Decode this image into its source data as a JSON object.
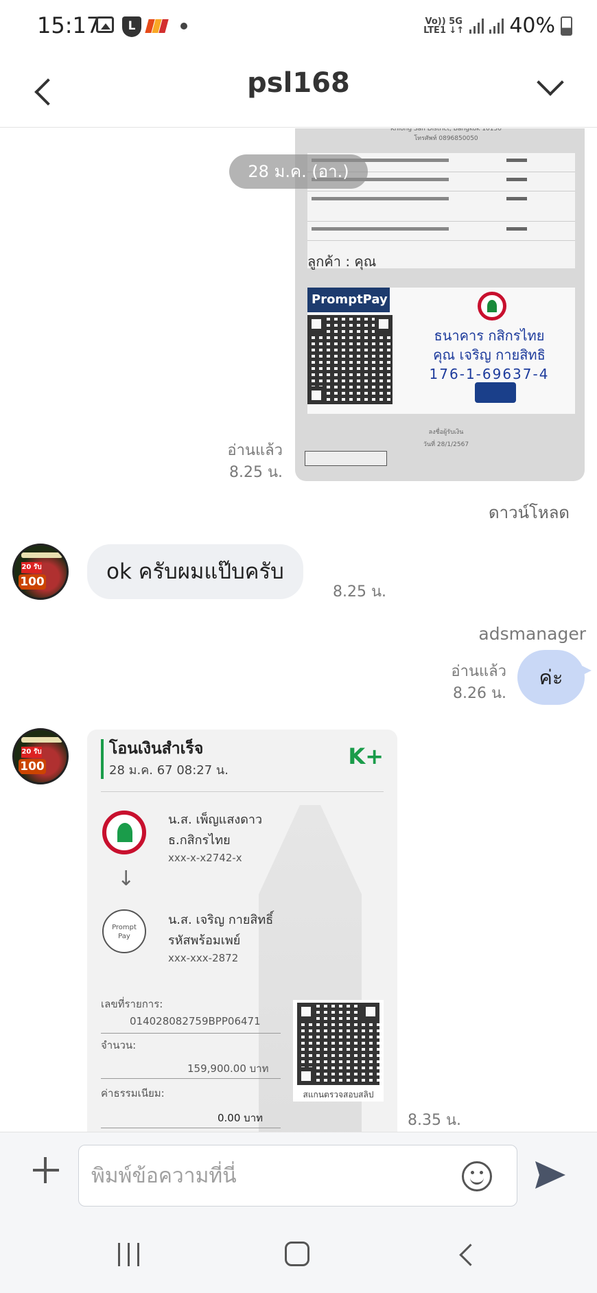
{
  "status_bar": {
    "time": "15:17",
    "network_label_top": "Vo)) 5G",
    "network_label_bottom": "LTE1 ↓↑",
    "battery_percent": "40%",
    "icons": [
      "gallery-icon",
      "line-icon",
      "app-icon",
      "dot-icon",
      "signal-icon",
      "battery-icon"
    ]
  },
  "header": {
    "title": "psl168",
    "back_icon": "chevron-left-icon",
    "menu_icon": "chevron-down-icon"
  },
  "chat": {
    "date_chip": "28 ม.ค. (อา.)",
    "invoice_image": {
      "customer_label": "ลูกค้า : คุณ",
      "promptpay_label": "PromptPay",
      "bank_name": "ธนาคาร กสิกรไทย",
      "account_name": "คุณ เจริญ กายสิทธิ",
      "account_number": "176-1-69637-4",
      "read_status": "อ่านแล้ว",
      "time": "8.25 น.",
      "download_label": "ดาวน์โหลด"
    },
    "msg_in_1": {
      "text": "ok ครับผมแป๊บครับ",
      "time": "8.25 น."
    },
    "msg_out_1": {
      "sender": "adsmanager",
      "text": "ค่ะ",
      "read_status": "อ่านแล้ว",
      "time": "8.26 น."
    },
    "receipt_image": {
      "title": "โอนเงินสำเร็จ",
      "datetime": "28 ม.ค. 67  08:27 น.",
      "brand": "K+",
      "from_name": "น.ส. เพ็ญแสงดาว",
      "from_bank": "ธ.กสิกรไทย",
      "from_account": "xxx-x-x2742-x",
      "to_name": "น.ส. เจริญ กายสิทธิ์",
      "to_bank": "รหัสพร้อมเพย์",
      "to_account": "xxx-xxx-2872",
      "ref_label": "เลขที่รายการ:",
      "ref_value": "014028082759BPP06471",
      "amount_label": "จำนวน:",
      "amount_value": "159,900.00 บาท",
      "fee_label": "ค่าธรรมเนียม:",
      "fee_value": "0.00 บาท",
      "qr_label": "สแกนตรวจสอบสลิป",
      "time": "8.35 น."
    },
    "avatar_badge": "20 รับ",
    "avatar_number": "100"
  },
  "input_bar": {
    "placeholder": "พิมพ์ข้อความที่นี่",
    "plus_icon": "plus-icon",
    "emoji_icon": "emoji-icon",
    "send_icon": "send-icon"
  },
  "nav_bar": {
    "icons": [
      "recents-icon",
      "home-icon",
      "back-icon"
    ]
  }
}
